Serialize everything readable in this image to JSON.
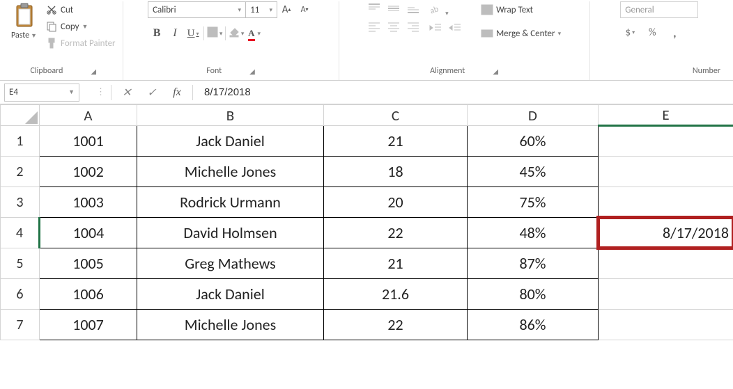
{
  "ribbon": {
    "clipboard": {
      "paste": "Paste",
      "cut": "Cut",
      "copy": "Copy",
      "format_painter": "Format Painter",
      "group_label": "Clipboard"
    },
    "font": {
      "name": "Calibri",
      "size": "11",
      "bold": "B",
      "italic": "I",
      "underline": "U",
      "increase_a": "A",
      "decrease_a": "A",
      "group_label": "Font"
    },
    "alignment": {
      "wrap_text": "Wrap Text",
      "merge_center": "Merge & Center",
      "group_label": "Alignment"
    },
    "number": {
      "format": "General",
      "currency": "$",
      "percent": "%",
      "comma": ",",
      "group_label": "Number"
    }
  },
  "formula_bar": {
    "cell_ref": "E4",
    "cancel": "✕",
    "enter": "✓",
    "fx": "fx",
    "value": "8/17/2018"
  },
  "columns": [
    "A",
    "B",
    "C",
    "D",
    "E"
  ],
  "selected_col": "E",
  "selected_row": 4,
  "rows": [
    {
      "n": 1,
      "A": "1001",
      "B": "Jack Daniel",
      "C": "21",
      "D": "60%",
      "E": ""
    },
    {
      "n": 2,
      "A": "1002",
      "B": "Michelle Jones",
      "C": "18",
      "D": "45%",
      "E": ""
    },
    {
      "n": 3,
      "A": "1003",
      "B": "Rodrick Urmann",
      "C": "20",
      "D": "75%",
      "E": ""
    },
    {
      "n": 4,
      "A": "1004",
      "B": "David Holmsen",
      "C": "22",
      "D": "48%",
      "E": "8/17/2018"
    },
    {
      "n": 5,
      "A": "1005",
      "B": "Greg Mathews",
      "C": "21",
      "D": "87%",
      "E": ""
    },
    {
      "n": 6,
      "A": "1006",
      "B": "Jack Daniel",
      "C": "21.6",
      "D": "80%",
      "E": ""
    },
    {
      "n": 7,
      "A": "1007",
      "B": "Michelle Jones",
      "C": "22",
      "D": "86%",
      "E": ""
    }
  ]
}
